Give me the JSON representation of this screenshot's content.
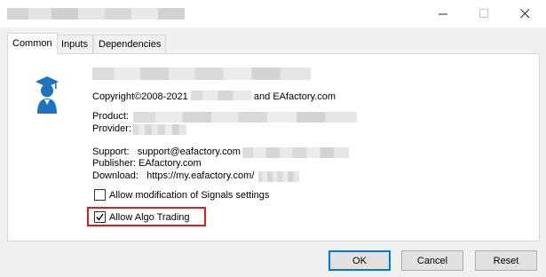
{
  "window": {
    "minimize_glyph": "—",
    "maximize_glyph": "☐",
    "close_glyph": "✕"
  },
  "tabs": [
    {
      "label": "Common"
    },
    {
      "label": "Inputs"
    },
    {
      "label": "Dependencies"
    }
  ],
  "info": {
    "copyright_prefix": "Copyright©2008-2021",
    "copyright_suffix": "and EAfactory.com",
    "product_label": "Product:",
    "provider_label": "Provider:",
    "support_label": "Support:",
    "support_value": "support@eafactory.com",
    "publisher_label": "Publisher:",
    "publisher_value": "EAfactory.com",
    "download_label": "Download:",
    "download_value": "https://my.eafactory.com/"
  },
  "options": {
    "allow_signals_label": "Allow modification of Signals settings",
    "allow_signals_checked": false,
    "allow_algo_label": "Allow Algo Trading",
    "allow_algo_checked": true
  },
  "buttons": {
    "ok": "OK",
    "cancel": "Cancel",
    "reset": "Reset"
  },
  "colors": {
    "highlight": "#e01b1b",
    "accent": "#0078d7",
    "icon_blue": "#1e73be"
  }
}
